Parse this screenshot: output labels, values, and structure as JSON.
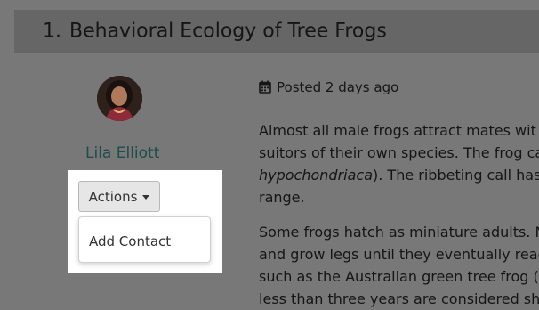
{
  "article": {
    "number": "1.",
    "title": "Behavioral Ecology of Tree Frogs"
  },
  "author": {
    "name": "Lila Elliott"
  },
  "actions": {
    "button_label": "Actions",
    "menu_items": [
      "Add Contact"
    ]
  },
  "meta": {
    "posted": "Posted 2 days ago",
    "icon": "calendar-icon"
  },
  "body": {
    "paragraph1": {
      "line1": "Almost all male frogs attract mates wit",
      "line2": "suitors of their own species. The frog ca",
      "line3_italic": "hypochondriaca",
      "line3_rest": "). The ribbeting call has",
      "line4": "range."
    },
    "paragraph2": {
      "line1": "Some frogs hatch as miniature adults. N",
      "line2": "and grow legs until they eventually reac",
      "line3": "such as the Australian green tree frog (",
      "line4": "less than three years are considered sh"
    }
  },
  "colors": {
    "overlay_background": "#787878",
    "title_bar": "#666666",
    "link": "#1c4d4a",
    "button_background": "#e6e6e6"
  }
}
